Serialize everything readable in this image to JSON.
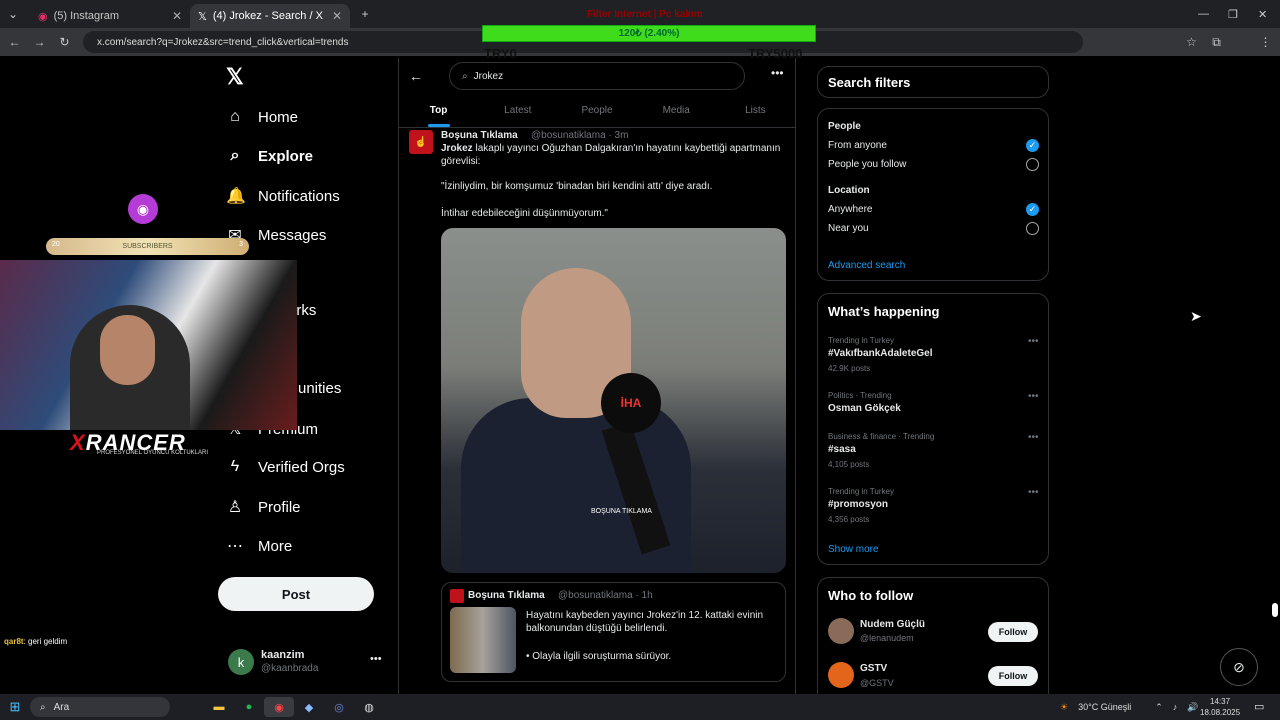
{
  "browser": {
    "tabs": [
      {
        "label": "(5) Instagram",
        "close": "✕"
      },
      {
        "label": "(4) Jrokez - Search / X",
        "close": "✕"
      }
    ],
    "new_tab": "+",
    "url": "x.com/search?q=Jrokez&src=trend_click&vertical=trends"
  },
  "overlay": {
    "top_text": "Filter Internet | Pc kakım",
    "bar_text": "120₺ (2.40%)",
    "left_label": "TRY0",
    "right_label": "TRY5000"
  },
  "sidebar": {
    "items": [
      {
        "label": "Home",
        "icon": "⌂"
      },
      {
        "label": "Explore",
        "icon": "⌕"
      },
      {
        "label": "Notifications",
        "icon": "🔔"
      },
      {
        "label": "Messages",
        "icon": "✉"
      },
      {
        "label": "arks",
        "icon": ""
      },
      {
        "label": "unities",
        "icon": ""
      },
      {
        "label": "Premium",
        "icon": "𝕏"
      },
      {
        "label": "Verified Orgs",
        "icon": "ϟ"
      },
      {
        "label": "Profile",
        "icon": "♙"
      },
      {
        "label": "More",
        "icon": "⋯"
      }
    ],
    "post_label": "Post",
    "account": {
      "name": "kaanzim",
      "handle": "@kaanbrada",
      "avatar_letter": "k"
    }
  },
  "main": {
    "search_value": "Jrokez",
    "tabs": [
      "Top",
      "Latest",
      "People",
      "Media",
      "Lists"
    ],
    "tweet": {
      "name": "Boşuna Tıklama",
      "handle": "@bosunatiklama · 3m",
      "body_bold": "Jrokez",
      "body": "lakaplı yayıncı Oğuzhan Dalgakıran'ın hayatını kaybettiği apartmanın görevlisi:",
      "quote1": "\"İzinliydim, bir komşumuz 'binadan biri kendini attı' diye aradı.",
      "quote2": "İntihar edebileceğini düşünmüyorum.\"",
      "media_brand": "İHA",
      "watermark": "BOŞUNA TIKLAMA"
    },
    "quoted": {
      "name": "Boşuna Tıklama",
      "handle": "@bosunatiklama · 1h",
      "text": "Hayatını kaybeden yayıncı Jrokez'in 12. kattaki evinin balkonundan düştüğü belirlendi.",
      "text2": "• Olayla ilgili soruşturma sürüyor."
    }
  },
  "right": {
    "filters": {
      "title": "Search filters",
      "people_label": "People",
      "from_anyone": "From anyone",
      "people_you_follow": "People you follow",
      "location_label": "Location",
      "anywhere": "Anywhere",
      "near_you": "Near you",
      "advanced": "Advanced search"
    },
    "happening": {
      "title": "What’s happening",
      "trends": [
        {
          "meta": "Trending in Turkey",
          "name": "#VakıfbankAdaleteGel",
          "count": "42.9K posts"
        },
        {
          "meta": "Politics · Trending",
          "name": "Osman Gökçek",
          "count": ""
        },
        {
          "meta": "Business & finance · Trending",
          "name": "#sasa",
          "count": "4,105 posts"
        },
        {
          "meta": "Trending in Turkey",
          "name": "#promosyon",
          "count": "4,356 posts"
        }
      ],
      "show_more": "Show more"
    },
    "who_to_follow": {
      "title": "Who to follow",
      "people": [
        {
          "name": "Nudem Güçlü",
          "handle": "@lenanudem",
          "button": "Follow"
        },
        {
          "name": "GSTV",
          "handle": "@GSTV",
          "button": "Follow"
        }
      ]
    }
  },
  "stream": {
    "sub_left": "20",
    "sub_label": "SUBSCRIBERS",
    "sub_right": "3",
    "brand_x": "X",
    "brand_rest": "RANCER",
    "brand_sub": "PROFESYONEL OYUNCU KOLTUKLARI",
    "chat_user": "qar8t",
    "chat_msg": ": geri geldim"
  },
  "taskbar": {
    "search_label": "Ara",
    "weather": "30°C  Güneşli",
    "time": "14:37",
    "date": "18.08.2025"
  }
}
